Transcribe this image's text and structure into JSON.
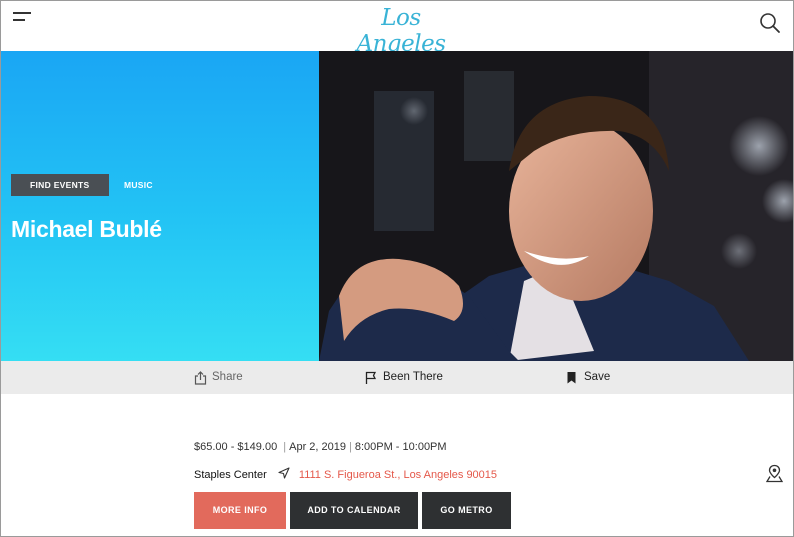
{
  "header": {
    "logo_text": "Los Angeles",
    "menu_icon": "hamburger-menu-icon",
    "search_icon": "search-icon"
  },
  "hero": {
    "find_events_label": "FIND EVENTS",
    "category_label": "MUSIC",
    "title": "Michael Bublé",
    "gradient_colors": [
      "#1aa6f4",
      "#35def3"
    ]
  },
  "actions": {
    "share_label": "Share",
    "been_there_label": "Been There",
    "save_label": "Save"
  },
  "event": {
    "price": "$65.00 - $149.00",
    "date": "Apr 2, 2019",
    "time": "8:00PM - 10:00PM",
    "venue": "Staples Center",
    "address": "1111 S. Figueroa St., Los Angeles 90015"
  },
  "buttons": {
    "more_info": "MORE INFO",
    "add_to_calendar": "ADD TO CALENDAR",
    "go_metro": "GO METRO"
  },
  "colors": {
    "accent_red": "#e26a5c",
    "address_red": "#e4584a",
    "dark_button": "#2e3032",
    "logo_blue": "#39b3d6"
  }
}
